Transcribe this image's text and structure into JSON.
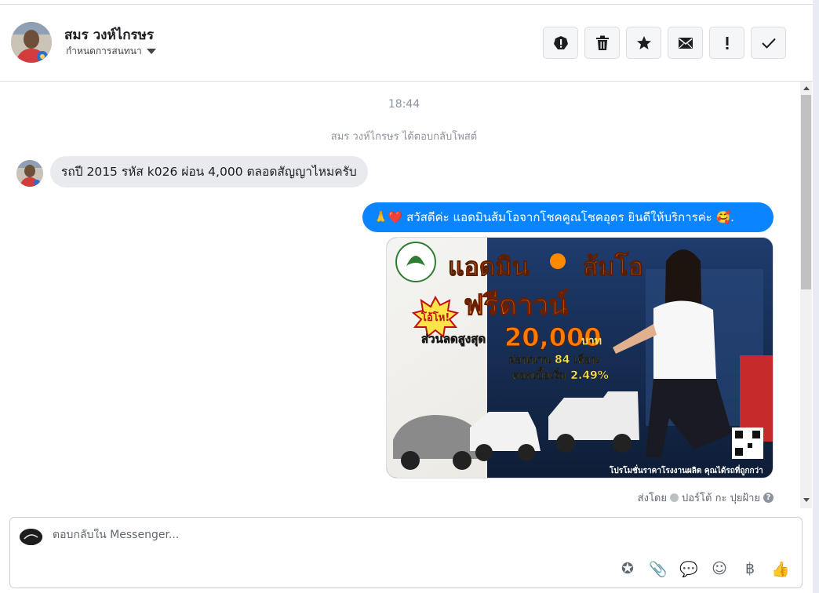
{
  "header": {
    "contact_name": "สมร วงห์ไกรษร",
    "assign_label": "กำหนดการสนทนา",
    "actions": [
      {
        "icon": "alert-circle-icon",
        "name": "mark-spam-button"
      },
      {
        "icon": "trash-icon",
        "name": "delete-button"
      },
      {
        "icon": "star-icon",
        "name": "star-button"
      },
      {
        "icon": "envelope-icon",
        "name": "mark-unread-button"
      },
      {
        "icon": "exclamation-icon",
        "name": "follow-up-button"
      },
      {
        "icon": "check-icon",
        "name": "mark-done-button"
      }
    ]
  },
  "chat": {
    "timestamp": "18:44",
    "reply_note": "สมร วงห์ไกรษร ได้ตอบกลับโพสต์",
    "incoming_message": "รถปี 2015 รหัส k026 ผ่อน 4,000 ตลอดสัญญาไหมครับ",
    "outgoing_message": "🙏❤️ สวัสดีค่ะ แอดมินส้มโอจากโชคคูณโชคอุดร ยินดีให้บริการค่ะ 🥰.",
    "promo": {
      "headline_1": "แอดมิน",
      "headline_2": "ส้มโอ",
      "badge": "โอ้โห!",
      "headline_free": "ฟรีดาวน์",
      "discount_label": "ส่วนลดสูงสุด",
      "discount_amount": "20,000",
      "discount_unit": "บาท",
      "installment": "ผ่อนนาน 84 เดือน",
      "interest": "ดอกเบี้ยเริ่ม 2.49%",
      "footer": "โปรโมชั่นราคาโรงงานผลิต คุณได้รถที่ถูกกว่า"
    },
    "sent_by_label": "ส่งโดย",
    "sent_by_name": "ปอร์โต้ กะ ปุยฝ้าย",
    "help_glyph": "?"
  },
  "composer": {
    "placeholder": "ตอบกลับใน Messenger...",
    "tools": [
      {
        "name": "saved-reply-icon",
        "glyph": "✪"
      },
      {
        "name": "attach-icon",
        "glyph": "📎"
      },
      {
        "name": "chat-bubble-icon",
        "glyph": "💬"
      },
      {
        "name": "emoji-icon",
        "glyph": "☺"
      },
      {
        "name": "baht-icon",
        "glyph": "฿"
      },
      {
        "name": "like-icon",
        "glyph": "👍"
      }
    ]
  },
  "colors": {
    "outgoing_bubble": "#0a84ff",
    "incoming_bubble": "#e9eaed",
    "promo_accent": "#ff7a00",
    "promo_green": "#ffe34a"
  }
}
